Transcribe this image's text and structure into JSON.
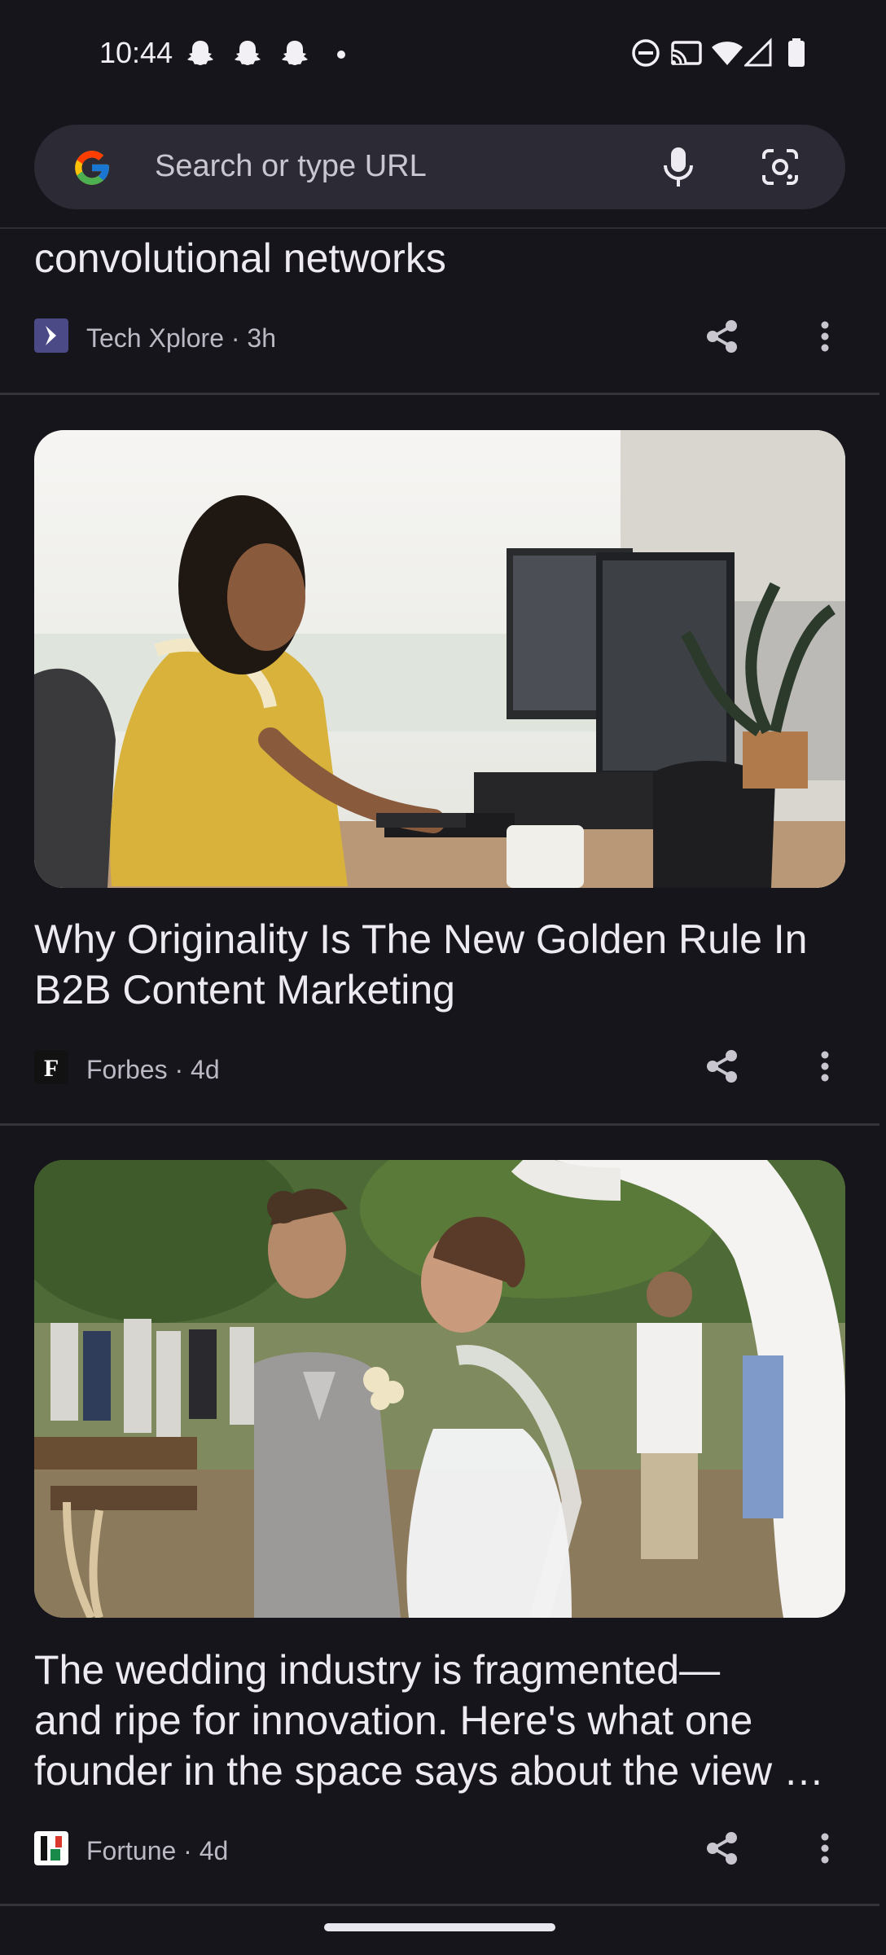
{
  "status_bar": {
    "time": "10:44",
    "notification_icons": [
      "snapchat-icon",
      "snapchat-icon",
      "snapchat-icon",
      "dot-icon"
    ],
    "system_icons": [
      "do-not-disturb-icon",
      "cast-icon",
      "wifi-icon",
      "signal-icon",
      "battery-icon"
    ]
  },
  "search": {
    "placeholder": "Search or type URL"
  },
  "articles": [
    {
      "headline": "convolutional networks",
      "source": "Tech Xplore",
      "age": "3h",
      "meta": "Tech Xplore · 3h"
    },
    {
      "headline": "Why Originality Is The New Golden Rule In B2B Content Marketing",
      "source": "Forbes",
      "age": "4d",
      "meta": "Forbes · 4d",
      "source_icon_letter": "F"
    },
    {
      "headline": "The wedding industry is fragmented—and ripe for innovation. Here's what one founder in the space says about the view …",
      "headline_lines": [
        "The wedding industry is fragmented—",
        "and ripe for innovation. Here's what one",
        "founder in the space says about the view …"
      ],
      "source": "Fortune",
      "age": "4d",
      "meta": "Fortune · 4d"
    }
  ],
  "colors": {
    "background": "#16151b",
    "search_bar": "#2c2a35",
    "divider": "#34333c"
  }
}
